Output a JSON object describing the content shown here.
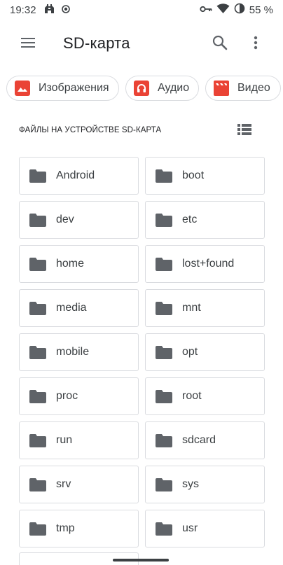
{
  "status_bar": {
    "time": "19:32",
    "battery_percent": "55 %"
  },
  "app_bar": {
    "title": "SD-карта"
  },
  "chips": [
    {
      "label": "Изображения",
      "icon": "image-icon"
    },
    {
      "label": "Аудио",
      "icon": "headphones-icon"
    },
    {
      "label": "Видео",
      "icon": "clapperboard-icon"
    }
  ],
  "section": {
    "label": "ФАЙЛЫ НА УСТРОЙСТВЕ SD-КАРТА"
  },
  "folders": [
    "Android",
    "boot",
    "dev",
    "etc",
    "home",
    "lost+found",
    "media",
    "mnt",
    "mobile",
    "opt",
    "proc",
    "root",
    "run",
    "sdcard",
    "srv",
    "sys",
    "tmp",
    "usr"
  ],
  "colors": {
    "accent_red": "#ea4335",
    "folder_gray": "#5f6368",
    "border": "#dadce0"
  }
}
